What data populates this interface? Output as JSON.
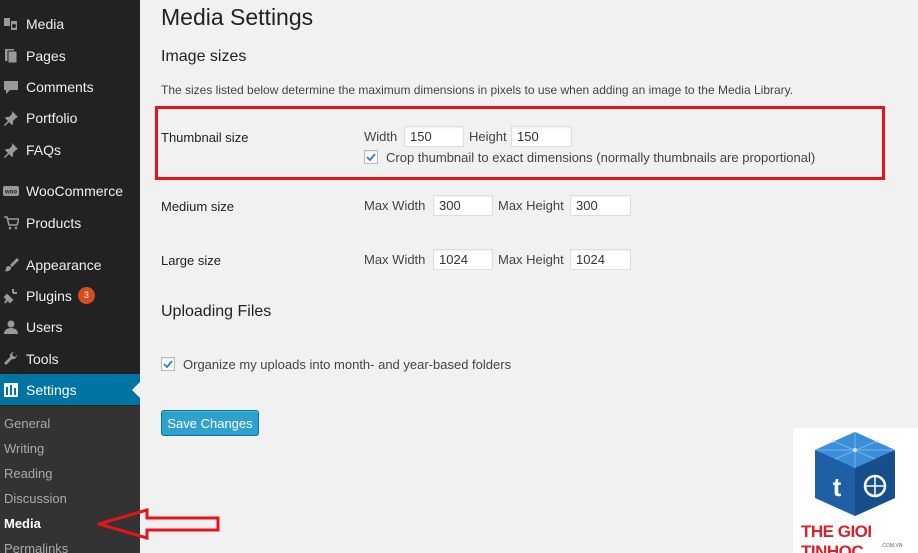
{
  "sidebar": {
    "items": [
      {
        "label": "Media",
        "icon": "media-icon"
      },
      {
        "label": "Pages",
        "icon": "pages-icon"
      },
      {
        "label": "Comments",
        "icon": "comments-icon"
      },
      {
        "label": "Portfolio",
        "icon": "pin-icon"
      },
      {
        "label": "FAQs",
        "icon": "pin-icon"
      },
      {
        "label": "WooCommerce",
        "icon": "woocommerce-icon"
      },
      {
        "label": "Products",
        "icon": "cart-icon"
      },
      {
        "label": "Appearance",
        "icon": "brush-icon"
      },
      {
        "label": "Plugins",
        "icon": "plug-icon",
        "badge": "3"
      },
      {
        "label": "Users",
        "icon": "user-icon"
      },
      {
        "label": "Tools",
        "icon": "wrench-icon"
      },
      {
        "label": "Settings",
        "icon": "settings-icon"
      }
    ],
    "submenu": [
      "General",
      "Writing",
      "Reading",
      "Discussion",
      "Media",
      "Permalinks"
    ]
  },
  "page": {
    "title": "Media Settings",
    "image_sizes_heading": "Image sizes",
    "description": "The sizes listed below determine the maximum dimensions in pixels to use when adding an image to the Media Library.",
    "thumbnail": {
      "label": "Thumbnail size",
      "width_label": "Width",
      "width_value": "150",
      "height_label": "Height",
      "height_value": "150",
      "crop_label": "Crop thumbnail to exact dimensions (normally thumbnails are proportional)",
      "crop_checked": true
    },
    "medium": {
      "label": "Medium size",
      "width_label": "Max Width",
      "width_value": "300",
      "height_label": "Max Height",
      "height_value": "300"
    },
    "large": {
      "label": "Large size",
      "width_label": "Max Width",
      "width_value": "1024",
      "height_label": "Max Height",
      "height_value": "1024"
    },
    "uploading_heading": "Uploading Files",
    "organize_label": "Organize my uploads into month- and year-based folders",
    "organize_checked": true,
    "save_label": "Save Changes"
  },
  "watermark": {
    "brand": "THE GIOI TINHOC",
    "domain": ".COM.VN"
  },
  "colors": {
    "sidebar_bg": "#222222",
    "active_bg": "#0074a2",
    "highlight_red": "#e4141b",
    "button_blue": "#2ea2cc",
    "badge_orange": "#d54e21"
  }
}
